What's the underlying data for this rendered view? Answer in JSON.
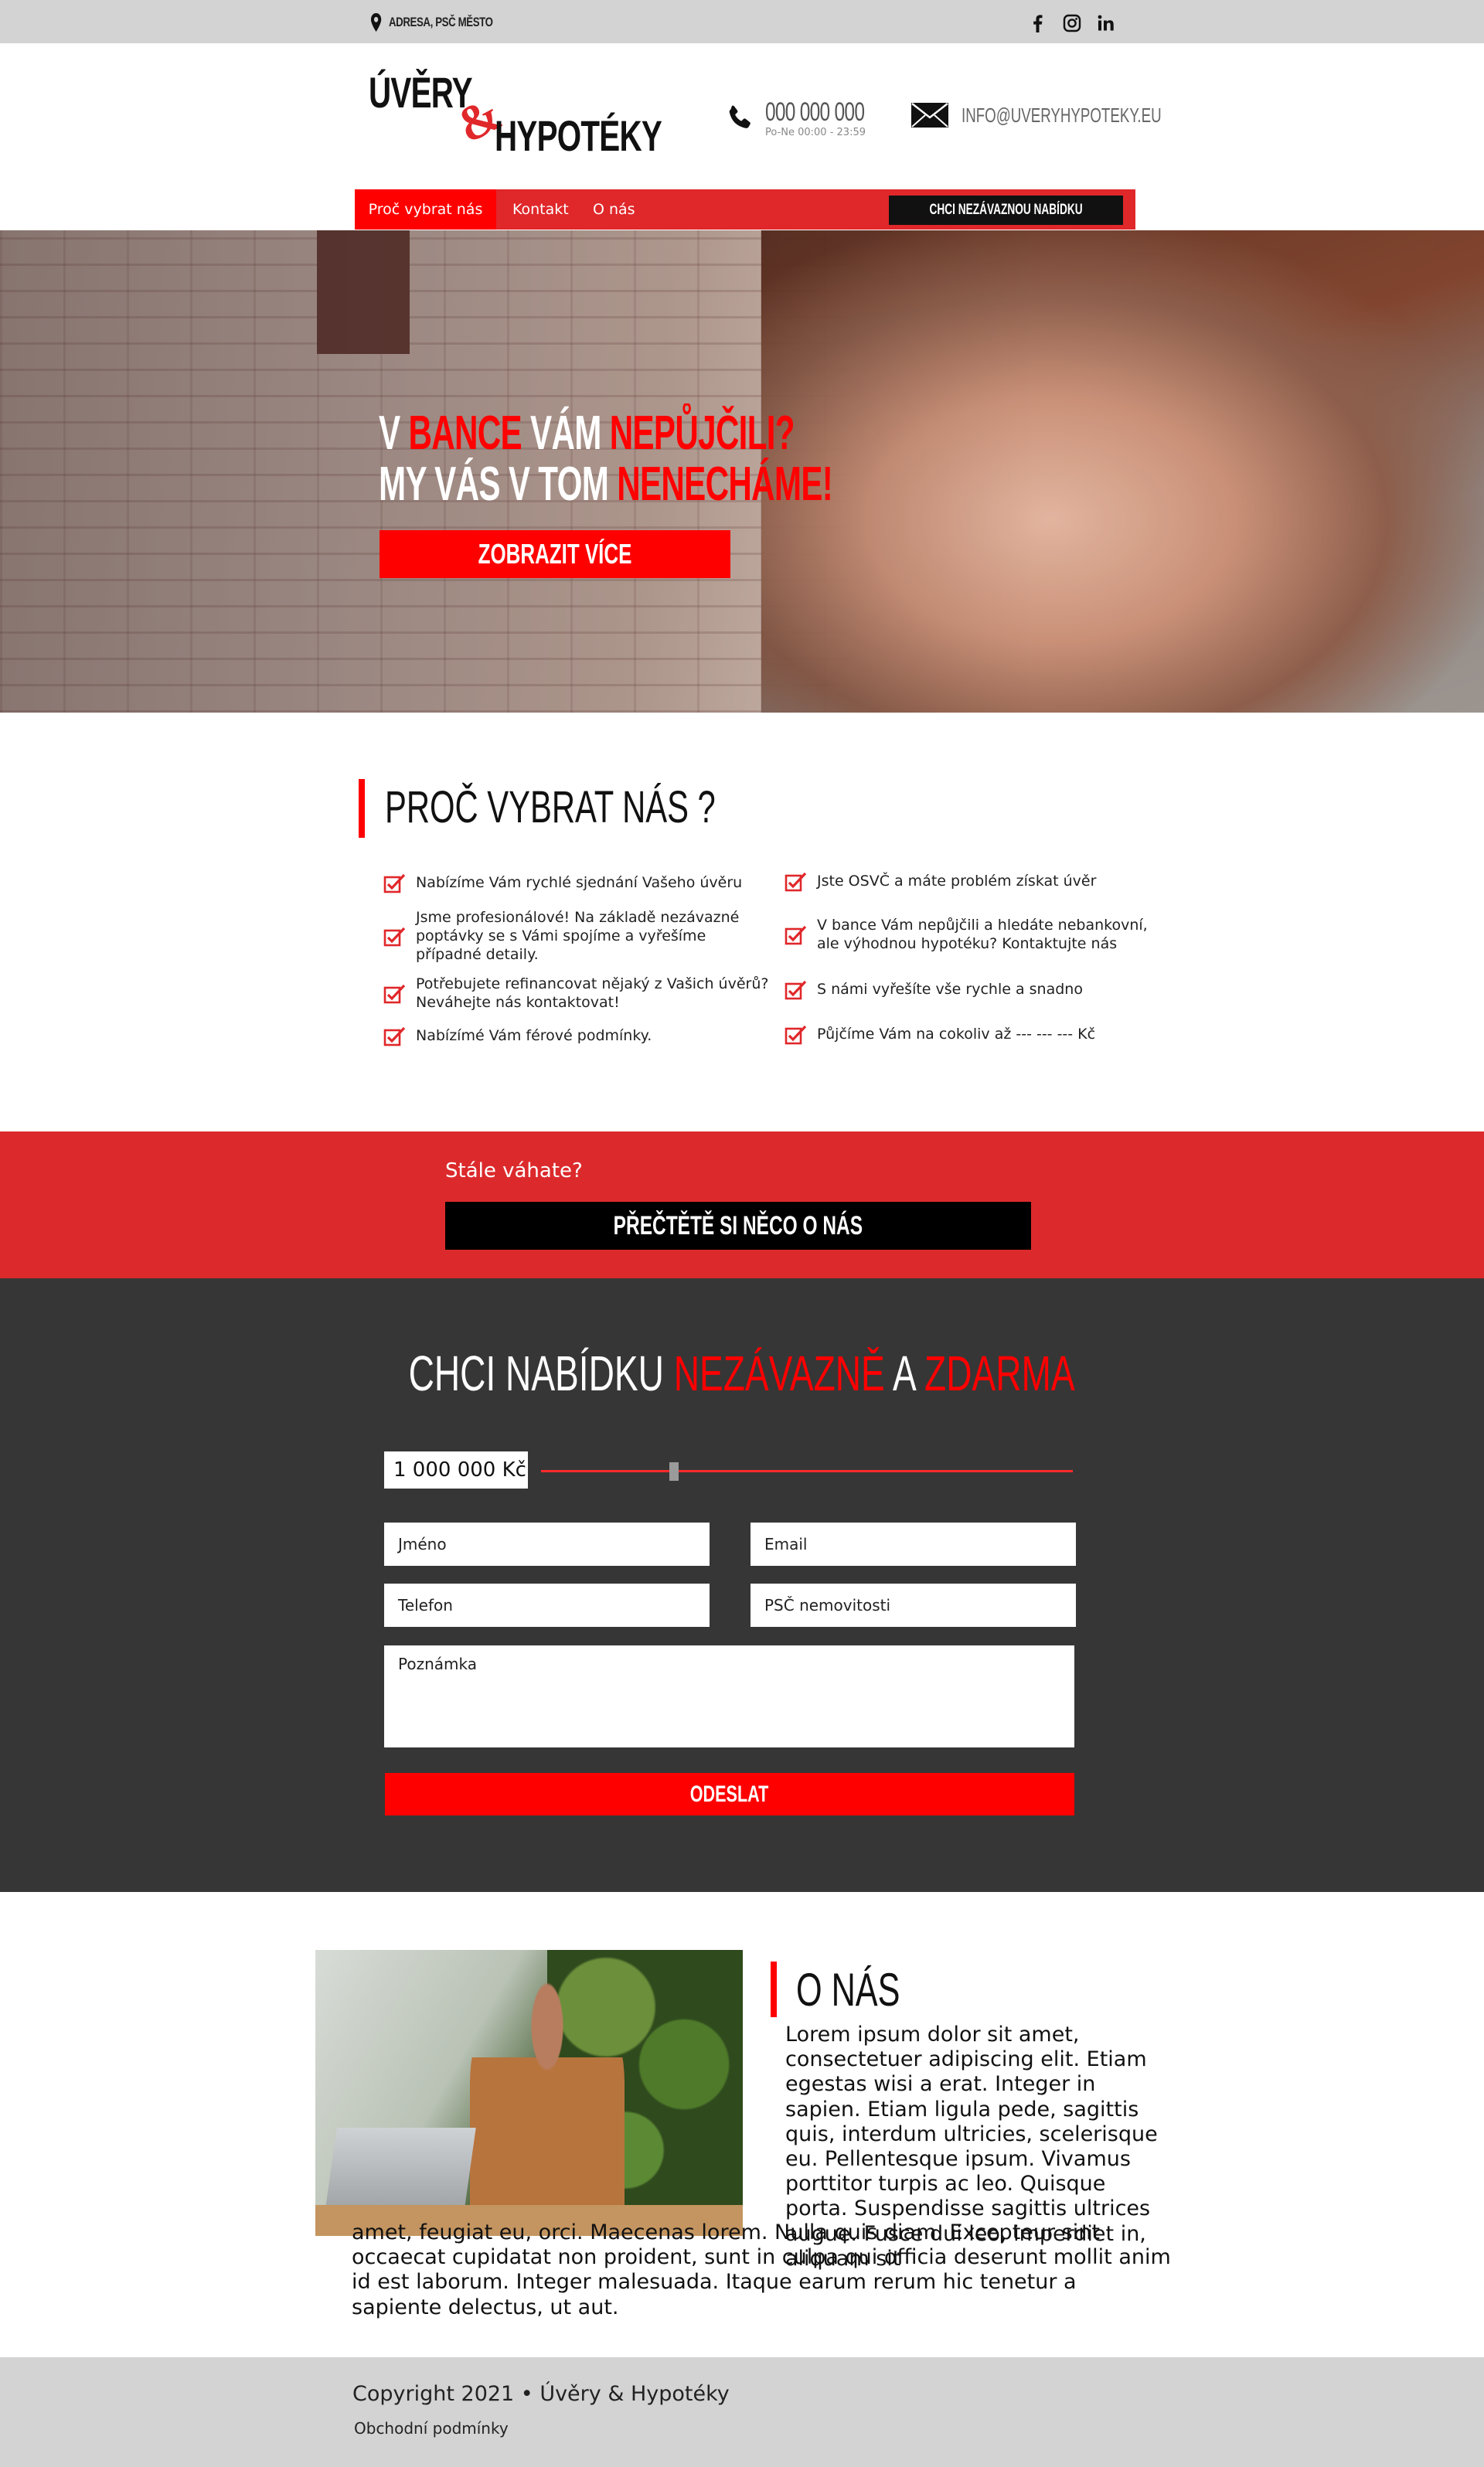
{
  "topbar": {
    "address": "ADRESA, PSČ MĚSTO",
    "social": [
      "facebook-icon",
      "instagram-icon",
      "linkedin-icon"
    ]
  },
  "header": {
    "logo_line1": "ÚVĚRY",
    "logo_amp": "&",
    "logo_line2": "HYPOTÉKY",
    "phone": "000 000 000",
    "hours": "Po-Ne 00:00 - 23:59",
    "email": "INFO@UVERYHYPOTEKY.EU"
  },
  "nav": {
    "items": [
      {
        "label": "Proč vybrat nás"
      },
      {
        "label": "Kontakt"
      },
      {
        "label": "O nás"
      }
    ],
    "cta": "CHCI NEZÁVAZNOU NABÍDKU"
  },
  "hero": {
    "l1_a": "V ",
    "l1_b": "BANCE",
    "l1_c": " VÁM ",
    "l1_d": "NEPŮJČILI?",
    "l2_a": "MY VÁS V TOM ",
    "l2_b": "NENECHÁME!",
    "button": "ZOBRAZIT VÍCE"
  },
  "why": {
    "title": "PROČ VYBRAT NÁS ?",
    "left": [
      "Nabízíme Vám rychlé sjednání Vašeho úvěru",
      "Jsme profesionálové! Na základě nezávazné poptávky se s Vámi spojíme a vyřešíme případné detaily.",
      "Potřebujete refinancovat nějaký z Vašich úvěrů? Neváhejte nás kontaktovat!",
      "Nabízímé Vám férové podmínky."
    ],
    "right": [
      "Jste OSVČ a máte problém získat úvěr",
      "V bance Vám nepůjčili a hledáte nebankovní, ale výhodnou hypotéku? Kontaktujte nás",
      "S námi vyřešíte vše rychle a snadno",
      "Půjčíme Vám na cokoliv až --- --- --- Kč"
    ]
  },
  "hesitate": {
    "text": "Stále váhate?",
    "button": "PŘEČTĚTĚ SI NĚCO O NÁS"
  },
  "form": {
    "title_a": "CHCI NABÍDKU ",
    "title_b": "NEZÁVAZNĚ",
    "title_c": " A ",
    "title_d": "ZDARMA",
    "amount": "1 000 000 Kč",
    "slider_fraction": 0.25,
    "name": "Jméno",
    "email": "Email",
    "phone": "Telefon",
    "psc": "PSČ nemovitosti",
    "note": "Poznámka",
    "submit": "ODESLAT"
  },
  "about": {
    "title": "O NÁS",
    "p1": "Lorem ipsum dolor sit amet, consectetuer adipiscing elit. Etiam egestas wisi a erat. Integer in sapien. Etiam ligula pede, sagittis quis, interdum ultricies, scelerisque eu. Pellentesque ipsum. Vivamus porttitor turpis ac leo. Quisque porta. Suspendisse sagittis ultrices augue. Fusce dui leo, imperdiet in, aliquam sit",
    "p2": "amet, feugiat eu, orci. Maecenas lorem. Nulla quis diam. Excepteur sint occaecat cupidatat non proident, sunt in culpa qui officia deserunt mollit anim id est laborum. Integer malesuada. Itaque earum rerum hic tenetur a sapiente delectus, ut aut."
  },
  "footer": {
    "copyright": "Copyright 2021 • Úvěry & Hypotéky",
    "terms": "Obchodní podmínky"
  },
  "colors": {
    "accent": "#ff0000",
    "nav_red": "#e0272a",
    "dark": "#363636",
    "grey": "#d3d3d3"
  }
}
